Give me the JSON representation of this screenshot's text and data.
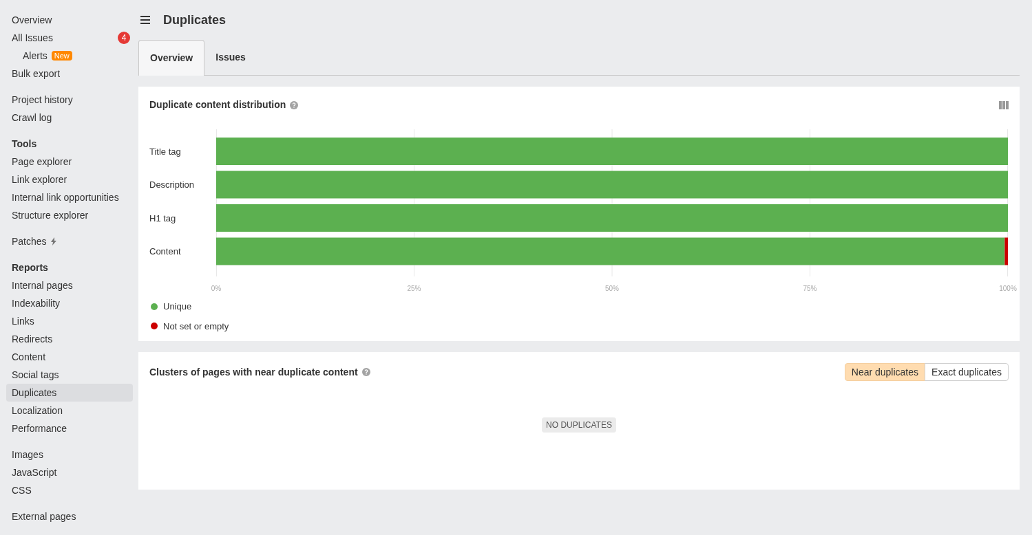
{
  "sidebar": {
    "sections": [
      {
        "items": [
          {
            "label": "Overview",
            "kind": "link",
            "selected": false
          },
          {
            "label": "All Issues",
            "kind": "link",
            "selected": false,
            "badge": "4",
            "children": [
              {
                "label": "Alerts",
                "kind": "link",
                "selected": false,
                "tag": "New"
              }
            ]
          },
          {
            "label": "Bulk export",
            "kind": "link",
            "selected": false
          }
        ]
      },
      {
        "items": [
          {
            "label": "Project history",
            "kind": "link",
            "selected": false
          },
          {
            "label": "Crawl log",
            "kind": "link",
            "selected": false
          }
        ]
      },
      {
        "items": [
          {
            "label": "Tools",
            "kind": "heading"
          },
          {
            "label": "Page explorer",
            "kind": "link",
            "selected": false
          },
          {
            "label": "Link explorer",
            "kind": "link",
            "selected": false
          },
          {
            "label": "Internal link opportunities",
            "kind": "link",
            "selected": false
          },
          {
            "label": "Structure explorer",
            "kind": "link",
            "selected": false
          }
        ]
      },
      {
        "items": [
          {
            "label": "Patches",
            "kind": "bolt",
            "selected": false
          }
        ]
      },
      {
        "items": [
          {
            "label": "Reports",
            "kind": "heading"
          },
          {
            "label": "Internal pages",
            "kind": "link",
            "selected": false
          },
          {
            "label": "Indexability",
            "kind": "link",
            "selected": false
          },
          {
            "label": "Links",
            "kind": "link",
            "selected": false
          },
          {
            "label": "Redirects",
            "kind": "link",
            "selected": false
          },
          {
            "label": "Content",
            "kind": "link",
            "selected": false
          },
          {
            "label": "Social tags",
            "kind": "link",
            "selected": false
          },
          {
            "label": "Duplicates",
            "kind": "link",
            "selected": true
          },
          {
            "label": "Localization",
            "kind": "link",
            "selected": false
          },
          {
            "label": "Performance",
            "kind": "link",
            "selected": false
          }
        ]
      },
      {
        "items": [
          {
            "label": "Images",
            "kind": "link",
            "selected": false
          },
          {
            "label": "JavaScript",
            "kind": "link",
            "selected": false
          },
          {
            "label": "CSS",
            "kind": "link",
            "selected": false
          }
        ]
      },
      {
        "items": [
          {
            "label": "External pages",
            "kind": "link",
            "selected": false
          }
        ]
      }
    ]
  },
  "page": {
    "title": "Duplicates"
  },
  "tabs": [
    {
      "label": "Overview",
      "selected": true
    },
    {
      "label": "Issues",
      "selected": false
    }
  ],
  "distribution": {
    "title": "Duplicate content distribution",
    "chart_data": {
      "type": "bar",
      "orientation": "horizontal",
      "stacked": true,
      "categories": [
        "Title tag",
        "Description",
        "H1 tag",
        "Content"
      ],
      "series": [
        {
          "name": "Unique",
          "color": "#5cb050",
          "values": [
            100,
            100,
            100,
            99.6
          ]
        },
        {
          "name": "Not set or empty",
          "color": "#cc0000",
          "values": [
            0,
            0,
            0,
            0.4
          ]
        }
      ],
      "grid": true,
      "xlim": [
        0,
        100
      ],
      "xticks": [
        {
          "value": 0,
          "label": "0%"
        },
        {
          "value": 25,
          "label": "25%"
        },
        {
          "value": 50,
          "label": "50%"
        },
        {
          "value": 75,
          "label": "75%"
        },
        {
          "value": 100,
          "label": "100%"
        }
      ]
    }
  },
  "clusters": {
    "title": "Clusters of pages with near duplicate content",
    "toggle": [
      {
        "label": "Near duplicates",
        "selected": true
      },
      {
        "label": "Exact duplicates",
        "selected": false
      }
    ],
    "empty": "NO DUPLICATES"
  }
}
